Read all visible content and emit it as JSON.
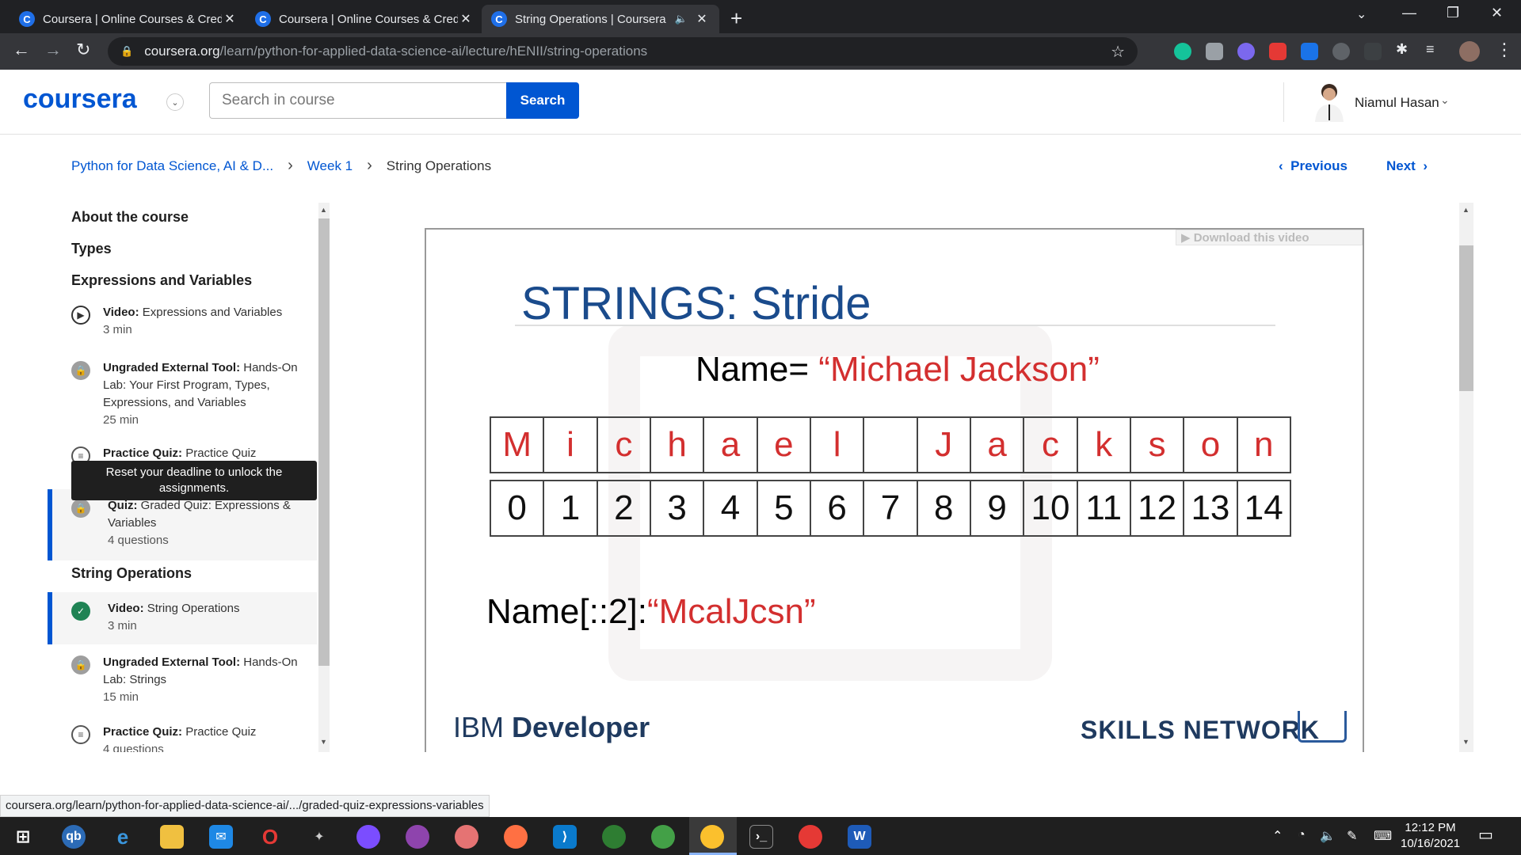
{
  "browser": {
    "tabs": [
      {
        "title": "Coursera | Online Courses & Credentials",
        "active": false
      },
      {
        "title": "Coursera | Online Courses & Credentials",
        "active": false
      },
      {
        "title": "String Operations | Coursera",
        "active": true
      }
    ],
    "favicon_letter": "C",
    "url_host": "coursera.org",
    "url_path": "/learn/python-for-applied-data-science-ai/lecture/hENII/string-operations",
    "status_url": "coursera.org/learn/python-for-applied-data-science-ai/.../graded-quiz-expressions-variables"
  },
  "header": {
    "logo": "coursera",
    "search_placeholder": "Search in course",
    "search_button": "Search",
    "user_name": "Niamul Hasan"
  },
  "breadcrumb": {
    "course": "Python for Data Science, AI & D...",
    "week": "Week 1",
    "current": "String Operations",
    "previous": "Previous",
    "next": "Next"
  },
  "sidebar": {
    "sections": [
      "About the course",
      "Types",
      "Expressions and Variables",
      "String Operations"
    ],
    "items": [
      {
        "type": "Video:",
        "title": "Expressions and Variables",
        "duration": "3 min",
        "icon": "play-icon"
      },
      {
        "type": "Ungraded External Tool:",
        "title": "Hands-On Lab: Your First Program, Types, Expressions, and Variables",
        "duration": "25 min",
        "icon": "lock-icon"
      },
      {
        "type": "Practice Quiz:",
        "title": "Practice Quiz",
        "duration": "",
        "icon": "quiz-icon"
      },
      {
        "type": "Quiz:",
        "title": "Graded Quiz: Expressions & Variables",
        "duration": "4 questions",
        "icon": "lock-icon"
      },
      {
        "type": "Video:",
        "title": "String Operations",
        "duration": "3 min",
        "icon": "check-icon"
      },
      {
        "type": "Ungraded External Tool:",
        "title": "Hands-On Lab: Strings",
        "duration": "15 min",
        "icon": "lock-icon"
      },
      {
        "type": "Practice Quiz:",
        "title": "Practice Quiz",
        "duration": "4 questions",
        "icon": "quiz-icon"
      }
    ],
    "tooltip": "Reset your deadline to unlock the assignments."
  },
  "slide": {
    "download": "Download this video",
    "title": "STRINGS: Stride",
    "name_label": "Name= ",
    "name_value": "“Michael Jackson”",
    "letters": [
      "M",
      "i",
      "c",
      "h",
      "a",
      "e",
      "l",
      " ",
      "J",
      "a",
      "c",
      "k",
      "s",
      "o",
      "n"
    ],
    "indices": [
      "0",
      "1",
      "2",
      "3",
      "4",
      "5",
      "6",
      "7",
      "8",
      "9",
      "10",
      "11",
      "12",
      "13",
      "14"
    ],
    "result_label": "Name[::2]:",
    "result_value": "“McalJcsn”",
    "footer_left_a": "IBM ",
    "footer_left_b": "Developer",
    "footer_right": "SKILLS NETWORK"
  },
  "taskbar": {
    "time": "12:12 PM",
    "date": "10/16/2021"
  }
}
